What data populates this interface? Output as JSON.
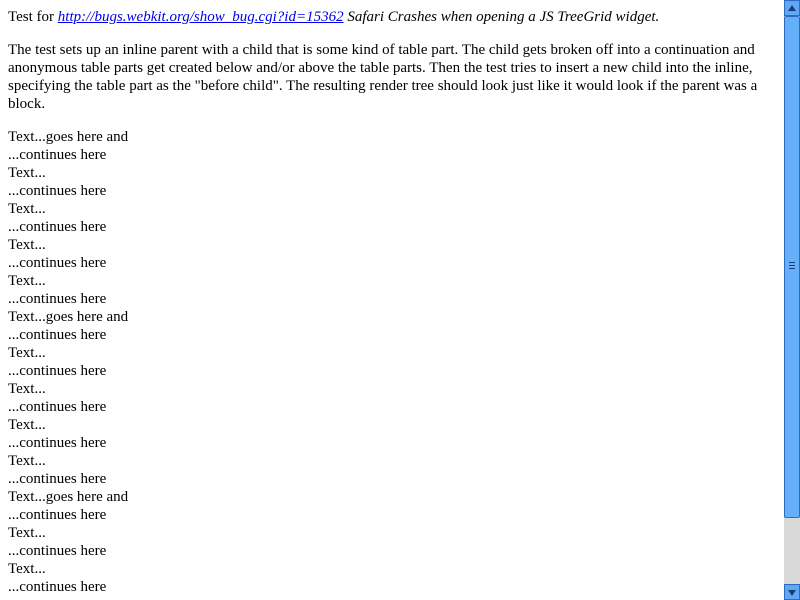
{
  "intro": {
    "prefix": "Test for ",
    "link_text": "http://bugs.webkit.org/show_bug.cgi?id=15362",
    "title": " Safari Crashes when opening a JS TreeGrid widget."
  },
  "description": "The test sets up an inline parent with a child that is some kind of table part. The child gets broken off into a continuation and anonymous table parts get created below and/or above the table parts. Then the test tries to insert a new child into the inline, specifying the table part as the \"before child\". The resulting render tree should look just like it would look if the parent was a block.",
  "lines": [
    "Text...goes here and",
    "...continues here",
    "Text...",
    "...continues here",
    "Text...",
    "...continues here",
    "Text...",
    "...continues here",
    "Text...",
    "...continues here",
    "Text...goes here and",
    "...continues here",
    "Text...",
    "...continues here",
    "Text...",
    "...continues here",
    "Text...",
    "...continues here",
    "Text...",
    "...continues here",
    "Text...goes here and",
    "...continues here",
    "Text...",
    "...continues here",
    "Text...",
    "...continues here"
  ],
  "icons": {
    "scroll_up": "triangle-up-icon",
    "scroll_down": "triangle-down-icon"
  },
  "colors": {
    "link": "#0000ee",
    "scrollbar_accent": "#5fa8f5"
  }
}
